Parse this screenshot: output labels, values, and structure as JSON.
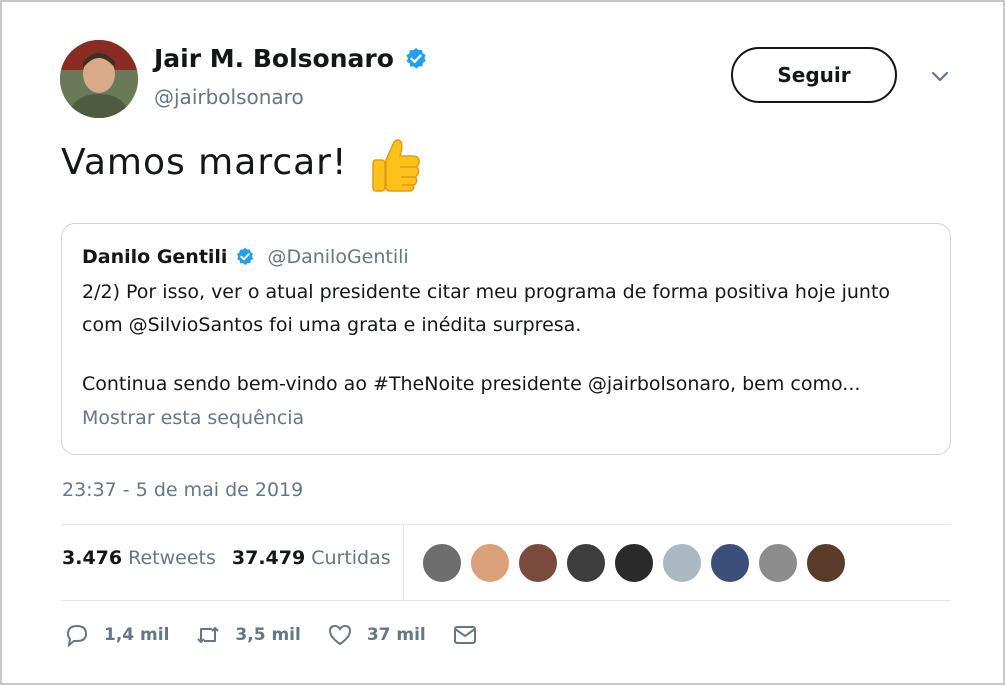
{
  "author": {
    "name": "Jair M. Bolsonaro",
    "handle": "@jairbolsonaro",
    "follow_label": "Seguir"
  },
  "tweet": {
    "text": "Vamos marcar!",
    "emoji": "thumbs-up-icon",
    "timestamp": "23:37 - 5 de mai de 2019"
  },
  "quote": {
    "name": "Danilo Gentili",
    "handle": "@DaniloGentili",
    "lines": [
      "2/2) Por isso, ver o atual presidente citar meu programa de forma positiva hoje junto",
      "com @SilvioSantos foi uma grata e inédita surpresa.",
      "Continua sendo bem-vindo ao #TheNoite presidente @jairbolsonaro, bem como..."
    ],
    "show_thread": "Mostrar esta sequência"
  },
  "stats": {
    "retweets_count": "3.476",
    "retweets_label": "Retweets",
    "likes_count": "37.479",
    "likes_label": "Curtidas"
  },
  "liker_colors": [
    "#6d6d6d",
    "#d9a07a",
    "#7a4a3c",
    "#3d3d3d",
    "#2a2a2a",
    "#aab8c2",
    "#3b4f7a",
    "#8c8c8c",
    "#5a3a28"
  ],
  "actions": {
    "reply_count": "1,4 mil",
    "retweet_count": "3,5 mil",
    "like_count": "37 mil"
  },
  "colors": {
    "verified": "#1da1f2",
    "secondary_text": "#657786",
    "border": "#e1e8ed"
  }
}
